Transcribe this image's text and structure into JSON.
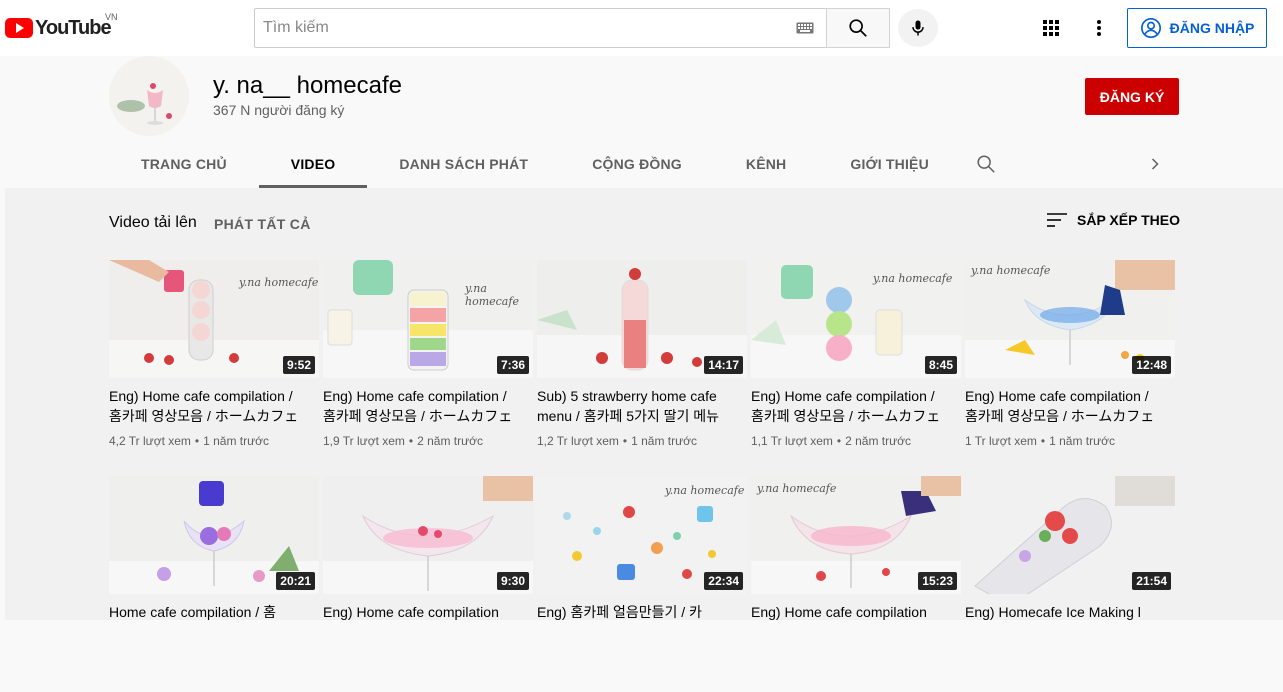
{
  "masthead": {
    "logo_text": "YouTube",
    "country_code": "VN",
    "search_placeholder": "Tìm kiếm",
    "signin_label": "ĐĂNG NHẬP"
  },
  "channel": {
    "name": "y. na__ homecafe",
    "subscribers": "367 N người đăng ký",
    "subscribe_label": "ĐĂNG KÝ",
    "tabs": [
      {
        "label": "TRANG CHỦ",
        "active": false
      },
      {
        "label": "VIDEO",
        "active": true
      },
      {
        "label": "DANH SÁCH PHÁT",
        "active": false
      },
      {
        "label": "CỘNG ĐỒNG",
        "active": false
      },
      {
        "label": "KÊNH",
        "active": false
      },
      {
        "label": "GIỚI THIỆU",
        "active": false
      }
    ]
  },
  "section": {
    "title": "Video tải lên",
    "play_all": "PHÁT TẤT CẢ",
    "sort_label": "SẮP XẾP THEO"
  },
  "videos": [
    {
      "title": "Eng) Home cafe compilation / 홈카페 영상모음 / ホームカフェ",
      "views": "4,2 Tr lượt xem",
      "age": "1 năm trước",
      "duration": "9:52",
      "watermark": "y.na homecafe"
    },
    {
      "title": "Eng) Home cafe compilation / 홈카페 영상모음 / ホームカフェ",
      "views": "1,9 Tr lượt xem",
      "age": "2 năm trước",
      "duration": "7:36",
      "watermark": "y.na homecafe"
    },
    {
      "title": "Sub) 5 strawberry home cafe menu / 홈카페 5가지 딸기 메뉴",
      "views": "1,2 Tr lượt xem",
      "age": "1 năm trước",
      "duration": "14:17",
      "watermark": ""
    },
    {
      "title": "Eng) Home cafe compilation / 홈카페 영상모음 / ホームカフェ",
      "views": "1,1 Tr lượt xem",
      "age": "2 năm trước",
      "duration": "8:45",
      "watermark": "y.na homecafe"
    },
    {
      "title": "Eng) Home cafe compilation / 홈카페 영상모음 / ホームカフェ",
      "views": "1 Tr lượt xem",
      "age": "1 năm trước",
      "duration": "12:48",
      "watermark": "y.na homecafe"
    },
    {
      "title": "Home cafe compilation / 홈",
      "views": "",
      "age": "",
      "duration": "20:21",
      "watermark": ""
    },
    {
      "title": "Eng) Home cafe compilation",
      "views": "",
      "age": "",
      "duration": "9:30",
      "watermark": ""
    },
    {
      "title": "Eng) 홈카페 얼음만들기 / 카",
      "views": "",
      "age": "",
      "duration": "22:34",
      "watermark": "y.na homecafe"
    },
    {
      "title": "Eng) Home cafe compilation",
      "views": "",
      "age": "",
      "duration": "15:23",
      "watermark": "y.na homecafe"
    },
    {
      "title": "Eng) Homecafe Ice Making l",
      "views": "",
      "age": "",
      "duration": "21:54",
      "watermark": ""
    }
  ],
  "icons": {
    "logo": "youtube-play-icon",
    "keyboard": "keyboard-icon",
    "search": "search-icon",
    "mic": "mic-icon",
    "apps": "apps-grid-icon",
    "more": "more-vert-icon",
    "account": "account-circle-icon",
    "sort": "sort-icon",
    "chevron": "chevron-right-icon"
  },
  "colors": {
    "brand_red": "#ff0000",
    "subscribe_red": "#cc0000",
    "link_blue": "#065fd4"
  }
}
